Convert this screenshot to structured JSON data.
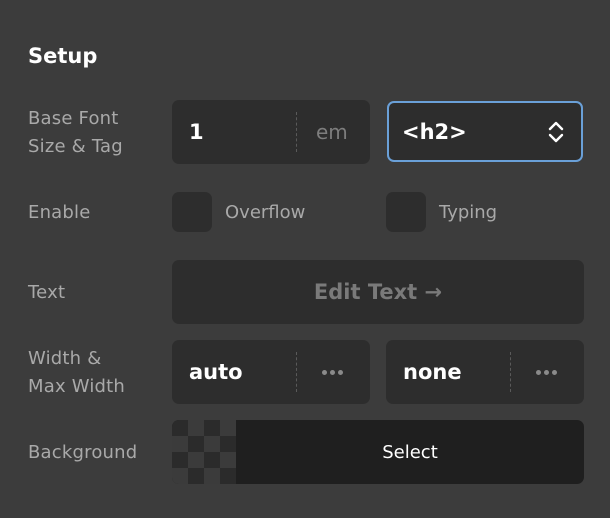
{
  "panel": {
    "title": "Setup"
  },
  "rows": {
    "font": {
      "label_line1": "Base Font",
      "label_line2": "Size & Tag",
      "size_value": "1",
      "size_unit": "em",
      "tag_value": "<h2>"
    },
    "enable": {
      "label": "Enable",
      "overflow_label": "Overflow",
      "overflow_checked": false,
      "typing_label": "Typing",
      "typing_checked": false
    },
    "text": {
      "label": "Text",
      "button_label": "Edit Text →"
    },
    "width": {
      "label_line1": "Width &",
      "label_line2": "Max Width",
      "width_value": "auto",
      "max_width_value": "none"
    },
    "background": {
      "label": "Background",
      "select_label": "Select"
    }
  },
  "colors": {
    "panel_bg": "#3c3c3c",
    "field_bg": "#2d2d2d",
    "focus_border": "#6aa0d8",
    "label_text": "#a9a9a9"
  },
  "icons": {
    "select_arrows": "chevron-up-down-icon",
    "more_options": "more-horizontal-icon",
    "transparency": "checkerboard-icon"
  }
}
